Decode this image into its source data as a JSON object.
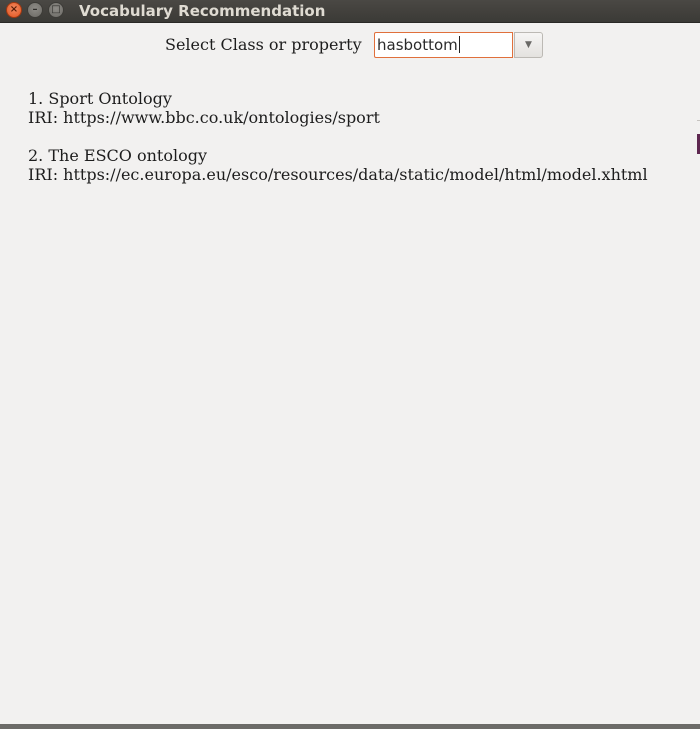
{
  "window": {
    "title": "Vocabulary Recommendation",
    "controls": {
      "close": "×",
      "minimize": "–",
      "maximize": "□"
    }
  },
  "selector": {
    "label": "Select Class or property",
    "value": "hasbottom",
    "dropdown_icon": "▼"
  },
  "results": [
    {
      "title": "1. Sport Ontology",
      "iri": "IRI: https://www.bbc.co.uk/ontologies/sport"
    },
    {
      "title": "2. The ESCO ontology",
      "iri": "IRI: https://ec.europa.eu/esco/resources/data/static/model/html/model.xhtml"
    }
  ],
  "colors": {
    "titlebar": "#3c3b37",
    "title_text": "#dfdbd2",
    "background": "#f2f1f0",
    "focus_border": "#e0703c",
    "close_button": "#e2541f"
  }
}
